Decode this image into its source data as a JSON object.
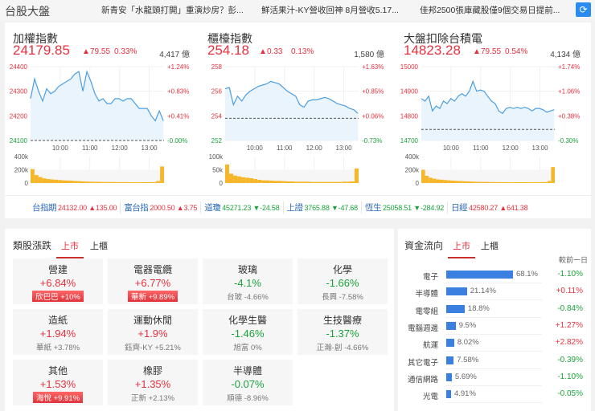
{
  "header": {
    "title": "台股大盤",
    "news": [
      "新青安「水龍頭打開」重演炒房？彭...",
      "鮮活果汁-KY營收回神 8月營收5.17...",
      "佳邦2500張庫藏股僅9個交易日提前..."
    ],
    "refresh_icon": "refresh-icon"
  },
  "colors": {
    "up": "#e5323e",
    "down": "#1aa33a",
    "line": "#4a9ee0",
    "volume": "#f5b62a",
    "accent": "#2a8cf0"
  },
  "indices": [
    {
      "name": "加權指數",
      "value": "24179.85",
      "change": "79.55",
      "pct": "0.33%",
      "amount": "4,417 億"
    },
    {
      "name": "櫃檯指數",
      "value": "254.18",
      "change": "0.33",
      "pct": "0.13%",
      "amount": "1,580 億"
    },
    {
      "name": "大盤扣除台積電",
      "value": "14823.28",
      "change": "79.55",
      "pct": "0.54%",
      "amount": "4,134 億"
    }
  ],
  "chart_data": [
    {
      "type": "line",
      "ylim": [
        24100,
        24400
      ],
      "yticks": [
        "24400",
        "24300",
        "24200",
        "24100"
      ],
      "rticks": [
        "+1.24%",
        "+0.83%",
        "+0.41%",
        "-0.00%"
      ],
      "ref": 24100,
      "xticks": [
        "10:00",
        "11:00",
        "12:00",
        "13:00"
      ],
      "vticks": [
        "400k",
        "200k",
        "0"
      ],
      "vmax": 400,
      "values": [
        24270,
        24350,
        24300,
        24260,
        24310,
        24290,
        24300,
        24320,
        24330,
        24340,
        24350,
        24370,
        24380,
        24300,
        24380,
        24340,
        24290,
        24260,
        24270,
        24250,
        24250,
        24270,
        24270,
        24260,
        24270,
        24270,
        24250,
        24230,
        24230,
        24230,
        24200,
        24180,
        24220,
        24180
      ],
      "volume": [
        210,
        120,
        90,
        70,
        60,
        55,
        50,
        45,
        40,
        38,
        35,
        30,
        28,
        25,
        22,
        20,
        18,
        18,
        16,
        15,
        15,
        14,
        14,
        13,
        13,
        12,
        12,
        12,
        12,
        12,
        13,
        14,
        30,
        250
      ]
    },
    {
      "type": "line",
      "ylim": [
        252,
        258
      ],
      "yticks": [
        "258",
        "256",
        "254",
        "252"
      ],
      "rticks": [
        "+1.63%",
        "+0.85%",
        "+0.06%",
        "-0.73%"
      ],
      "ref": 253.8,
      "xticks": [
        "10:00",
        "11:00",
        "12:00",
        "13:00"
      ],
      "vticks": [
        "100k",
        "50k",
        "0"
      ],
      "vmax": 100,
      "values": [
        256.2,
        256.3,
        254.9,
        255.6,
        255.2,
        255.7,
        256.0,
        256.2,
        256.4,
        256.5,
        256.6,
        256.8,
        256.7,
        256.6,
        256.3,
        256.0,
        255.8,
        255.6,
        254.9,
        254.7,
        255.2,
        255.3,
        255.3,
        255.4,
        255.5,
        255.4,
        255.2,
        255.0,
        254.9,
        254.8,
        254.6,
        254.5,
        254.2
      ],
      "volume": [
        70,
        35,
        28,
        25,
        22,
        20,
        18,
        15,
        12,
        10,
        10,
        9,
        8,
        8,
        7,
        6,
        6,
        5,
        5,
        5,
        5,
        4,
        4,
        4,
        4,
        4,
        4,
        4,
        4,
        5,
        5,
        6,
        55
      ]
    },
    {
      "type": "line",
      "ylim": [
        14700,
        15000
      ],
      "yticks": [
        "15000",
        "14900",
        "14800",
        "14700"
      ],
      "rticks": [
        "+1.74%",
        "+1.06%",
        "+0.38%",
        "-0.30%"
      ],
      "ref": 14745,
      "xticks": [
        "10:00",
        "11:00",
        "12:00",
        "13:00"
      ],
      "vticks": [
        "400k",
        "200k",
        "0"
      ],
      "vmax": 400,
      "values": [
        14870,
        14860,
        14880,
        14820,
        14840,
        14830,
        14860,
        14850,
        14870,
        14860,
        14880,
        14890,
        14880,
        14900,
        14940,
        14900,
        14905,
        14900,
        14880,
        14860,
        14850,
        14820,
        14810,
        14830,
        14835,
        14830,
        14835,
        14830,
        14835,
        14830,
        14820,
        14830,
        14830,
        14825,
        14815,
        14820,
        14825
      ],
      "volume": [
        200,
        110,
        80,
        65,
        55,
        50,
        45,
        40,
        36,
        32,
        30,
        28,
        25,
        22,
        20,
        18,
        17,
        16,
        15,
        14,
        14,
        13,
        13,
        12,
        12,
        12,
        12,
        12,
        12,
        12,
        12,
        13,
        13,
        14,
        30,
        240
      ]
    }
  ],
  "tickers": [
    {
      "label": "台指期",
      "value": "24132.00",
      "change": "▲135.00",
      "dir": "up"
    },
    {
      "label": "富台指",
      "value": "2000.50",
      "change": "▲3.75",
      "dir": "up"
    },
    {
      "label": "道瓊",
      "value": "45271.23",
      "change": "▼-24.58",
      "dir": "dn"
    },
    {
      "label": "上證",
      "value": "3765.88",
      "change": "▼-47.68",
      "dir": "dn"
    },
    {
      "label": "恆生",
      "value": "25058.51",
      "change": "▼-284.92",
      "dir": "dn"
    },
    {
      "label": "日經",
      "value": "42580.27",
      "change": "▲641.38",
      "dir": "up"
    }
  ],
  "sectors": {
    "title": "類股漲跌",
    "tabs": [
      "上市",
      "上櫃"
    ],
    "items": [
      {
        "name": "營建",
        "pct": "+6.84%",
        "stock": "欣巴巴  +10%",
        "dir": "up",
        "hot": true
      },
      {
        "name": "電器電纜",
        "pct": "+6.77%",
        "stock": "華新  +9.89%",
        "dir": "up",
        "hot": true
      },
      {
        "name": "玻璃",
        "pct": "-4.1%",
        "stock": "台玻  -4.66%",
        "dir": "dn"
      },
      {
        "name": "化學",
        "pct": "-1.66%",
        "stock": "長興  -7.58%",
        "dir": "dn"
      },
      {
        "name": "造紙",
        "pct": "+1.94%",
        "stock": "華紙  +3.78%",
        "dir": "up"
      },
      {
        "name": "運動休閒",
        "pct": "+1.9%",
        "stock": "鈺齊-KY  +5.21%",
        "dir": "up"
      },
      {
        "name": "化學生醫",
        "pct": "-1.46%",
        "stock": "旭富  0%",
        "dir": "dn"
      },
      {
        "name": "生技醫療",
        "pct": "-1.37%",
        "stock": "正瀚-創  -4.66%",
        "dir": "dn"
      },
      {
        "name": "其他",
        "pct": "+1.53%",
        "stock": "海悅  +9.91%",
        "dir": "up",
        "hot": true
      },
      {
        "name": "橡膠",
        "pct": "+1.35%",
        "stock": "正新  +2.13%",
        "dir": "up"
      },
      {
        "name": "半導體",
        "pct": "-0.07%",
        "stock": "順德  -8.96%",
        "dir": "dn"
      }
    ]
  },
  "flow": {
    "title": "資金流向",
    "tabs": [
      "上市",
      "上櫃"
    ],
    "col_header": "較前一日",
    "items": [
      {
        "name": "電子",
        "share": 68.1,
        "share_label": "68.1%",
        "change": "-1.10%",
        "dir": "dn"
      },
      {
        "name": "半導體",
        "share": 21.14,
        "share_label": "21.14%",
        "change": "+0.11%",
        "dir": "up"
      },
      {
        "name": "電零組",
        "share": 18.8,
        "share_label": "18.8%",
        "change": "-0.84%",
        "dir": "dn"
      },
      {
        "name": "電腦週邊",
        "share": 9.5,
        "share_label": "9.5%",
        "change": "+1.27%",
        "dir": "up"
      },
      {
        "name": "航運",
        "share": 8.02,
        "share_label": "8.02%",
        "change": "+2.82%",
        "dir": "up"
      },
      {
        "name": "其它電子",
        "share": 7.58,
        "share_label": "7.58%",
        "change": "-0.39%",
        "dir": "dn"
      },
      {
        "name": "通信網路",
        "share": 5.69,
        "share_label": "5.69%",
        "change": "-1.10%",
        "dir": "dn"
      },
      {
        "name": "光電",
        "share": 4.91,
        "share_label": "4.91%",
        "change": "-0.05%",
        "dir": "dn"
      }
    ]
  }
}
